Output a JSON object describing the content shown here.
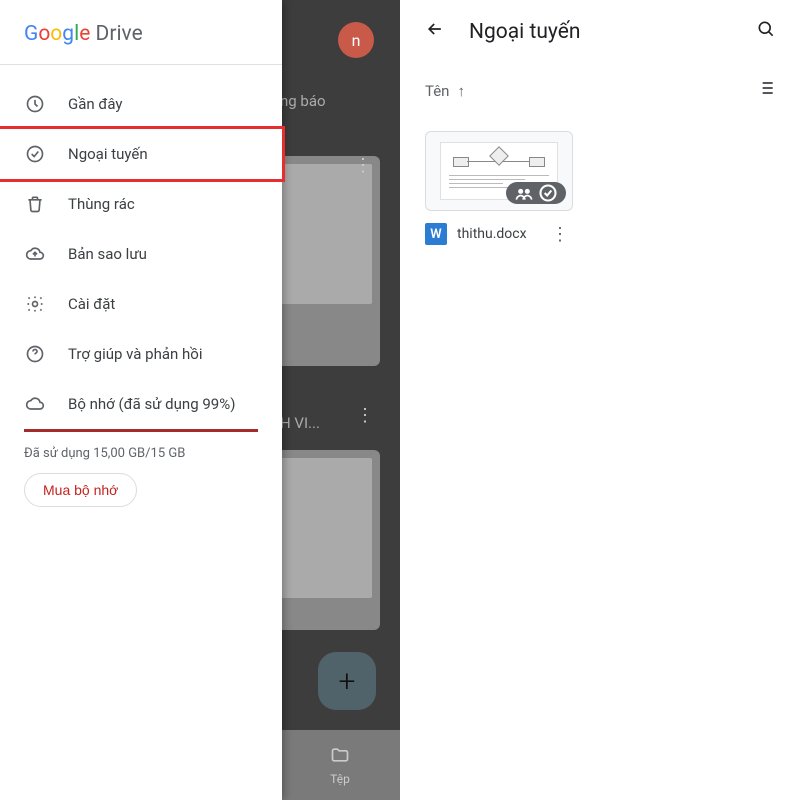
{
  "drawer": {
    "brand_drive": "Drive",
    "items": [
      {
        "icon": "clock",
        "label": "Gần đây"
      },
      {
        "icon": "offline",
        "label": "Ngoại tuyến",
        "highlighted": true
      },
      {
        "icon": "trash",
        "label": "Thùng rác"
      },
      {
        "icon": "cloud-up",
        "label": "Bản sao lưu"
      },
      {
        "icon": "gear",
        "label": "Cài đặt"
      },
      {
        "icon": "help",
        "label": "Trợ giúp và phản hồi"
      },
      {
        "icon": "cloud",
        "label": "Bộ nhớ (đã sử dụng 99%)"
      }
    ],
    "storage_used": "Đã sử dụng 15,00 GB/15 GB",
    "buy_label": "Mua bộ nhớ"
  },
  "background": {
    "avatar_initial": "n",
    "partial_text1": "ng báo",
    "partial_text2": "H VI...",
    "bottom_nav_label": "Tệp"
  },
  "right": {
    "title": "Ngoại tuyến",
    "sort_label": "Tên",
    "files": [
      {
        "name": "thithu.docx",
        "type": "word"
      }
    ]
  }
}
